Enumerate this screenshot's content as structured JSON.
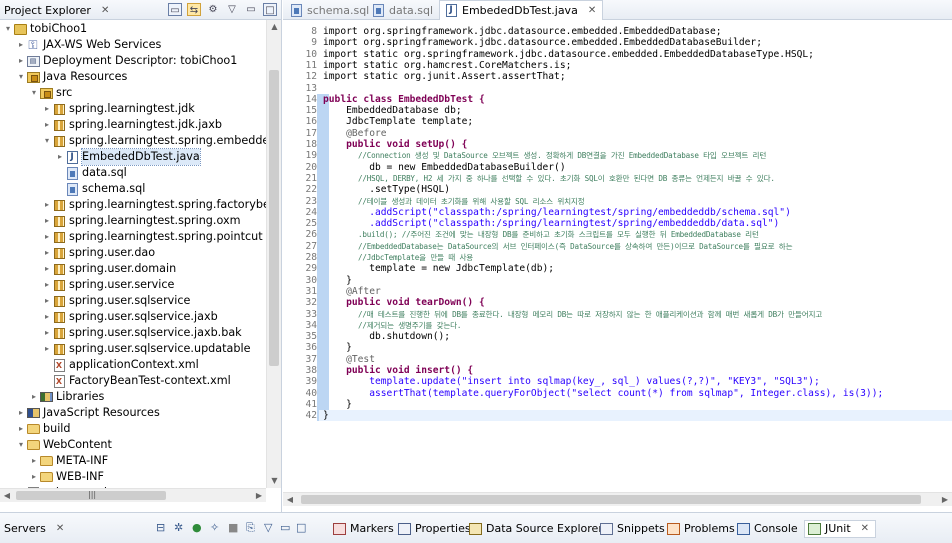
{
  "explorer": {
    "title": "Project Explorer",
    "close": "✕",
    "items": [
      {
        "label": "tobiChoo1",
        "depth": 0,
        "icon": "project-icon",
        "twisty": "▾"
      },
      {
        "label": "JAX-WS Web Services",
        "depth": 1,
        "icon": "web-services-icon",
        "twisty": "▸"
      },
      {
        "label": "Deployment Descriptor: tobiChoo1",
        "depth": 1,
        "icon": "deployment-descriptor-icon",
        "twisty": "▸"
      },
      {
        "label": "Java Resources",
        "depth": 1,
        "icon": "java-resources-icon",
        "twisty": "▾"
      },
      {
        "label": "src",
        "depth": 2,
        "icon": "source-folder-icon",
        "twisty": "▾"
      },
      {
        "label": "spring.learningtest.jdk",
        "depth": 3,
        "icon": "package-icon",
        "twisty": "▸"
      },
      {
        "label": "spring.learningtest.jdk.jaxb",
        "depth": 3,
        "icon": "package-icon",
        "twisty": "▸"
      },
      {
        "label": "spring.learningtest.spring.embeddeddb",
        "depth": 3,
        "icon": "package-icon",
        "twisty": "▾"
      },
      {
        "label": "EmbededDbTest.java",
        "depth": 4,
        "icon": "java-file-icon",
        "twisty": "▸",
        "selected": true
      },
      {
        "label": "data.sql",
        "depth": 4,
        "icon": "sql-file-icon",
        "twisty": ""
      },
      {
        "label": "schema.sql",
        "depth": 4,
        "icon": "sql-file-icon",
        "twisty": ""
      },
      {
        "label": "spring.learningtest.spring.factorybean",
        "depth": 3,
        "icon": "package-icon",
        "twisty": "▸"
      },
      {
        "label": "spring.learningtest.spring.oxm",
        "depth": 3,
        "icon": "package-icon",
        "twisty": "▸"
      },
      {
        "label": "spring.learningtest.spring.pointcut",
        "depth": 3,
        "icon": "package-icon",
        "twisty": "▸"
      },
      {
        "label": "spring.user.dao",
        "depth": 3,
        "icon": "package-icon",
        "twisty": "▸"
      },
      {
        "label": "spring.user.domain",
        "depth": 3,
        "icon": "package-icon",
        "twisty": "▸"
      },
      {
        "label": "spring.user.service",
        "depth": 3,
        "icon": "package-icon",
        "twisty": "▸"
      },
      {
        "label": "spring.user.sqlservice",
        "depth": 3,
        "icon": "package-icon",
        "twisty": "▸"
      },
      {
        "label": "spring.user.sqlservice.jaxb",
        "depth": 3,
        "icon": "package-icon",
        "twisty": "▸"
      },
      {
        "label": "spring.user.sqlservice.jaxb.bak",
        "depth": 3,
        "icon": "package-icon",
        "twisty": "▸"
      },
      {
        "label": "spring.user.sqlservice.updatable",
        "depth": 3,
        "icon": "package-icon",
        "twisty": "▸"
      },
      {
        "label": "applicationContext.xml",
        "depth": 3,
        "icon": "xml-file-icon",
        "twisty": ""
      },
      {
        "label": "FactoryBeanTest-context.xml",
        "depth": 3,
        "icon": "xml-file-icon",
        "twisty": ""
      },
      {
        "label": "Libraries",
        "depth": 2,
        "icon": "libraries-icon",
        "twisty": "▸"
      },
      {
        "label": "JavaScript Resources",
        "depth": 1,
        "icon": "javascript-resources-icon",
        "twisty": "▸"
      },
      {
        "label": "build",
        "depth": 1,
        "icon": "folder-icon",
        "twisty": "▸"
      },
      {
        "label": "WebContent",
        "depth": 1,
        "icon": "folder-icon",
        "twisty": "▾"
      },
      {
        "label": "META-INF",
        "depth": 2,
        "icon": "folder-icon",
        "twisty": "▸"
      },
      {
        "label": "WEB-INF",
        "depth": 2,
        "icon": "folder-icon",
        "twisty": "▸"
      },
      {
        "label": "sqlmap.xsd",
        "depth": 1,
        "icon": "xsd-file-icon",
        "twisty": ""
      }
    ]
  },
  "editor": {
    "tabs": [
      {
        "label": "schema.sql",
        "active": false
      },
      {
        "label": "data.sql",
        "active": false
      },
      {
        "label": "EmbededDbTest.java",
        "active": true
      }
    ],
    "close": "✕",
    "lines": [
      {
        "n": "8",
        "t": "import org.springframework.jdbc.datasource.embedded.EmbeddedDatabase;",
        "c": "import"
      },
      {
        "n": "9",
        "t": "import org.springframework.jdbc.datasource.embedded.EmbeddedDatabaseBuilder;",
        "c": "import"
      },
      {
        "n": "10",
        "t": "import static org.springframework.jdbc.datasource.embedded.EmbeddedDatabaseType.HSQL;",
        "c": "import"
      },
      {
        "n": "11",
        "t": "import static org.hamcrest.CoreMatchers.is;",
        "c": "import"
      },
      {
        "n": "12",
        "t": "import static org.junit.Assert.assertThat;",
        "c": "import"
      },
      {
        "n": "13",
        "t": "",
        "c": ""
      },
      {
        "n": "14",
        "t": "public class EmbededDbTest {",
        "c": "kw"
      },
      {
        "n": "15",
        "t": "    EmbeddedDatabase db;",
        "c": ""
      },
      {
        "n": "16",
        "t": "    JdbcTemplate template;",
        "c": ""
      },
      {
        "n": "17",
        "t": "    @Before",
        "c": "ann"
      },
      {
        "n": "18",
        "t": "    public void setUp() {",
        "c": "kw"
      },
      {
        "n": "19",
        "t": "        //Connection 생성 및 DataSource 오브젝트 생성. 정확하게 DB연결을 가진 EmbeddedDatabase 타입 오브젝트 리턴",
        "c": "cmt small"
      },
      {
        "n": "20",
        "t": "        db = new EmbeddedDatabaseBuilder()",
        "c": ""
      },
      {
        "n": "21",
        "t": "        //HSQL, DERBY, H2 세 가지 중 하나를 선택할 수 있다. 초기화 SQL이 호환만 된다면 DB 종류는 언제든지 바꿀 수 있다.",
        "c": "cmt small"
      },
      {
        "n": "22",
        "t": "        .setType(HSQL)",
        "c": ""
      },
      {
        "n": "23",
        "t": "        //테이블 생성과 데이터 초기화를 위해 사용할 SQL 리소스 위치지정",
        "c": "cmt small"
      },
      {
        "n": "24",
        "t": "        .addScript(\"classpath:/spring/learningtest/spring/embeddeddb/schema.sql\")",
        "c": "str"
      },
      {
        "n": "25",
        "t": "        .addScript(\"classpath:/spring/learningtest/spring/embeddeddb/data.sql\")",
        "c": "str"
      },
      {
        "n": "26",
        "t": "        .build(); //주어진 조건에 맞는 내장형 DB를 준비하고 초기화 스크립트를 모두 실행한 뒤 EmbeddedDatabase 리턴",
        "c": "cmt small"
      },
      {
        "n": "27",
        "t": "        //EmbeddedDatabase는 DataSource의 서브 인터페이스(즉 DataSource를 상속하여 만든)이므로 DataSource를 필요로 하는",
        "c": "cmt small"
      },
      {
        "n": "28",
        "t": "        //JdbcTemplate을 만들 때 사용",
        "c": "cmt small"
      },
      {
        "n": "29",
        "t": "        template = new JdbcTemplate(db);",
        "c": ""
      },
      {
        "n": "30",
        "t": "    }",
        "c": ""
      },
      {
        "n": "31",
        "t": "    @After",
        "c": "ann"
      },
      {
        "n": "32",
        "t": "    public void tearDown() {",
        "c": "kw"
      },
      {
        "n": "33",
        "t": "        //매 테스트를 진행한 뒤에 DB를 종료한다. 내장형 메모리 DB는 따로 저장하지 않는 한 애플리케이션과 함께 매번 새롭게 DB가 만들어지고",
        "c": "cmt small"
      },
      {
        "n": "34",
        "t": "        //제거되는 생명주기를 갖는다.",
        "c": "cmt small"
      },
      {
        "n": "35",
        "t": "        db.shutdown();",
        "c": ""
      },
      {
        "n": "36",
        "t": "    }",
        "c": ""
      },
      {
        "n": "37",
        "t": "    @Test",
        "c": "ann"
      },
      {
        "n": "38",
        "t": "    public void insert() {",
        "c": "kw"
      },
      {
        "n": "39",
        "t": "        template.update(\"insert into sqlmap(key_, sql_) values(?,?)\", \"KEY3\", \"SQL3\");",
        "c": "str"
      },
      {
        "n": "40",
        "t": "        assertThat(template.queryForObject(\"select count(*) from sqlmap\", Integer.class), is(3));",
        "c": "str"
      },
      {
        "n": "41",
        "t": "    }",
        "c": ""
      },
      {
        "n": "42",
        "t": "}",
        "c": ""
      }
    ]
  },
  "bottom": {
    "servers": "Servers",
    "tabs": [
      "Markers",
      "Properties",
      "Data Source Explorer",
      "Snippets",
      "Problems",
      "Console",
      "JUnit"
    ],
    "close": "✕"
  }
}
